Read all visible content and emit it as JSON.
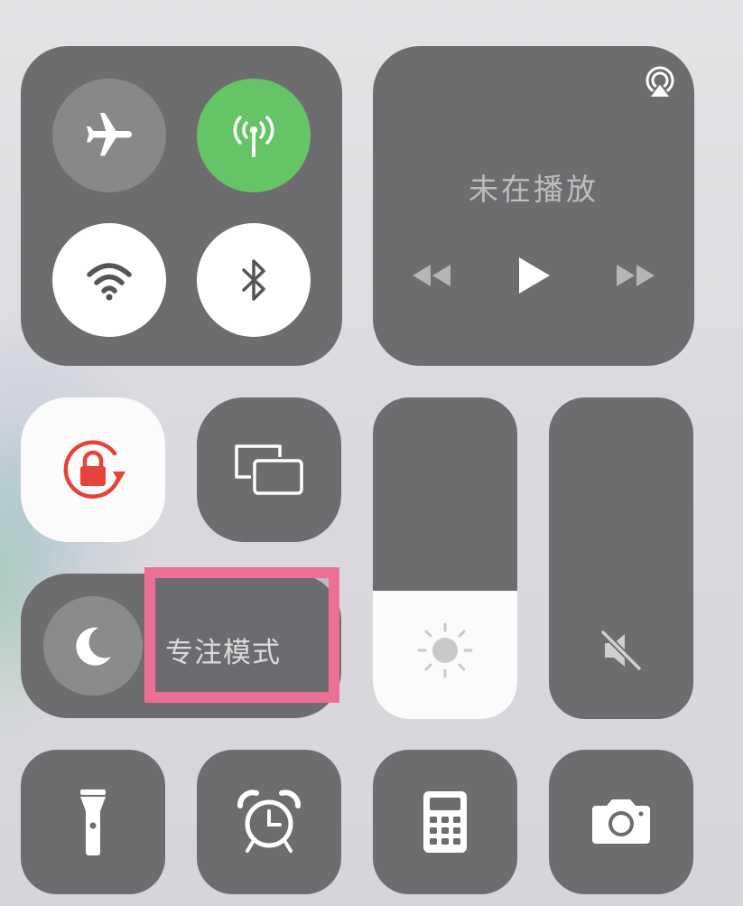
{
  "connectivity": {
    "airplane_mode": {
      "icon": "airplane-icon",
      "state": "off",
      "color": "#88888b"
    },
    "cellular_data": {
      "icon": "cellular-antenna-icon",
      "state": "on",
      "color": "#65c466"
    },
    "wifi": {
      "icon": "wifi-icon",
      "state": "on",
      "color": "#ffffff"
    },
    "bluetooth": {
      "icon": "bluetooth-icon",
      "state": "on",
      "color": "#ffffff"
    }
  },
  "media": {
    "status": "未在播放",
    "airplay_icon": "airplay-audio-icon",
    "controls": [
      "rewind-icon",
      "play-icon",
      "fast-forward-icon"
    ]
  },
  "orientation_lock": {
    "icon": "rotation-lock-icon",
    "state": "on",
    "color": "#e5443b"
  },
  "screen_mirroring": {
    "icon": "screen-mirroring-icon"
  },
  "focus": {
    "label": "专注模式",
    "icon": "moon-icon",
    "highlight_color": "#ec6f95"
  },
  "brightness": {
    "icon": "sun-icon",
    "level": 0.4
  },
  "volume": {
    "icon": "speaker-muted-icon",
    "level": 0.0
  },
  "shortcuts": [
    "flashlight-icon",
    "alarm-clock-icon",
    "calculator-icon",
    "camera-icon"
  ]
}
